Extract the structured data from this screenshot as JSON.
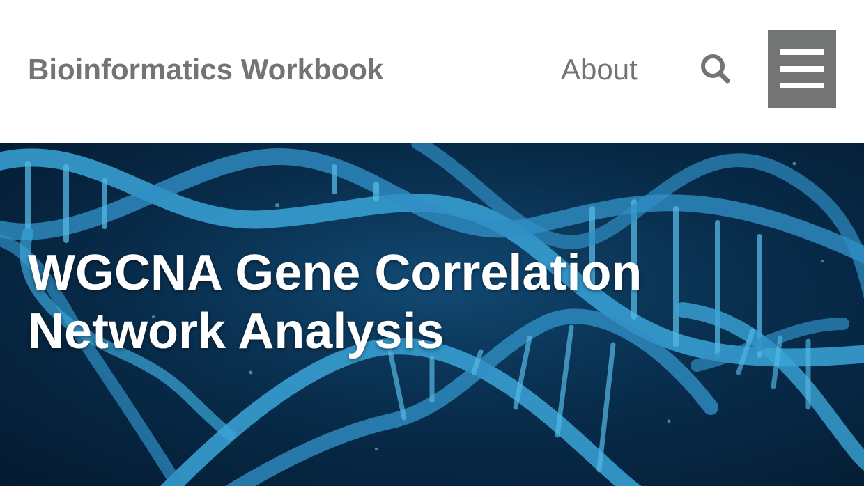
{
  "header": {
    "site_title": "Bioinformatics Workbook",
    "nav": {
      "about_label": "About"
    },
    "search_icon": "search-icon",
    "menu_icon": "hamburger-menu-icon"
  },
  "hero": {
    "title": "WGCNA Gene Correlation Network Analysis",
    "background_image": "dna-double-helix"
  },
  "colors": {
    "header_text": "#737474",
    "menu_button_bg": "#737474",
    "hero_bg": "#072a48",
    "helix": "#3aa5d8",
    "hero_title": "#ffffff"
  }
}
